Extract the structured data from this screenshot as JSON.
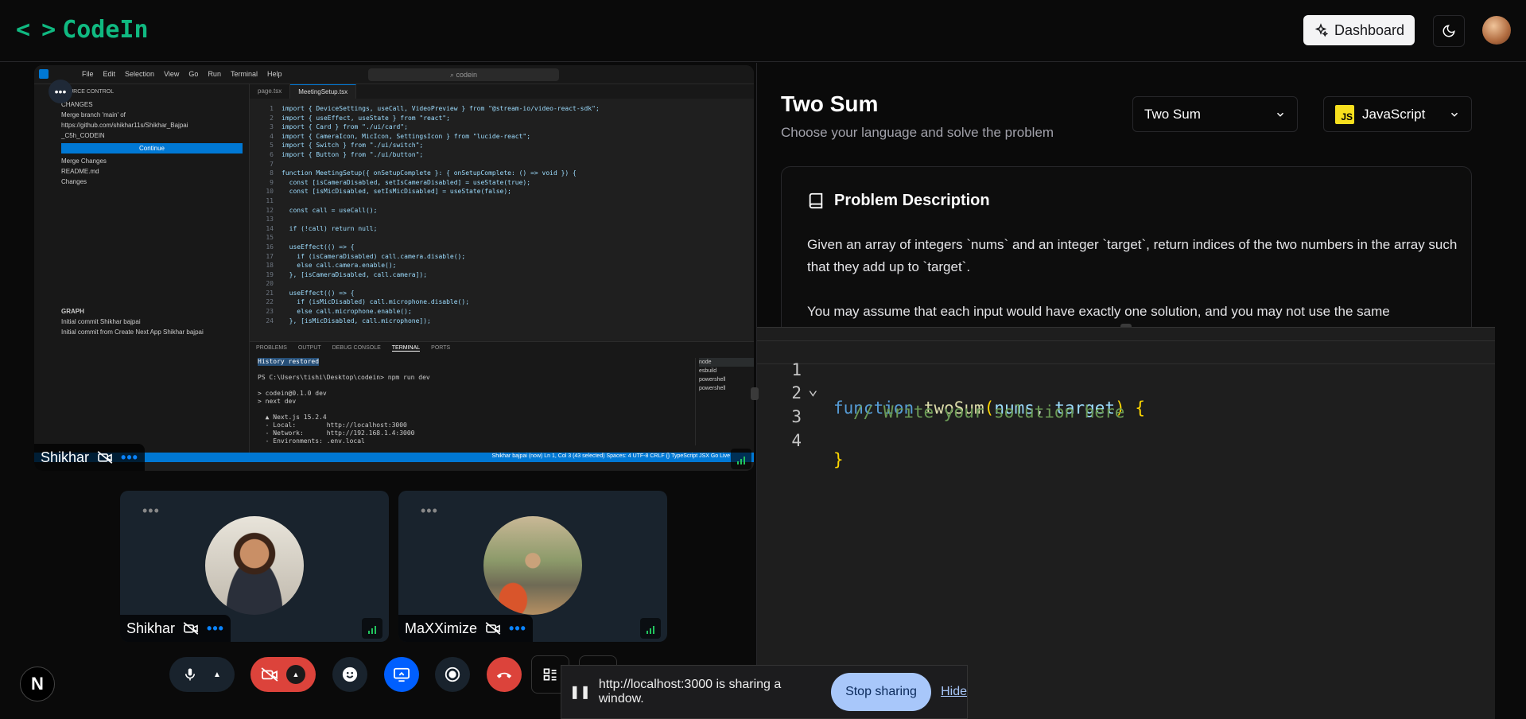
{
  "app": {
    "logo_text": "CodeIn",
    "logo_glyph": "< >"
  },
  "topbar": {
    "dashboard_label": "Dashboard"
  },
  "screenshare": {
    "presenter_name": "Shikhar",
    "vscode": {
      "menu": [
        "File",
        "Edit",
        "Selection",
        "View",
        "Go",
        "Run",
        "Terminal",
        "Help"
      ],
      "search": "codein",
      "tabs": [
        "page.tsx",
        "MeetingSetup.tsx"
      ],
      "side_title": "SOURCE CONTROL",
      "side_lines": [
        "CHANGES",
        "Merge branch 'main' of",
        "https://github.com/shikhar11s/Shikhar_Bajpai",
        "_C5h_CODEIN",
        "Continue",
        "Merge Changes",
        "README.md",
        "Changes",
        "GRAPH",
        "Initial commit  Shikhar bajpai",
        "Initial commit from Create Next App  Shikhar bajpai"
      ],
      "code": [
        "import { DeviceSettings, useCall, VideoPreview } from \"@stream-io/video-react-sdk\";",
        "import { useEffect, useState } from \"react\";",
        "import { Card } from \"./ui/card\";",
        "import { CameraIcon, MicIcon, SettingsIcon } from \"lucide-react\";",
        "import { Switch } from \"./ui/switch\";",
        "import { Button } from \"./ui/button\";",
        "",
        "function MeetingSetup({ onSetupComplete }: { onSetupComplete: () => void }) {",
        "  const [isCameraDisabled, setIsCameraDisabled] = useState(true);",
        "  const [isMicDisabled, setIsMicDisabled] = useState(false);",
        "",
        "  const call = useCall();",
        "",
        "  if (!call) return null;",
        "",
        "  useEffect(() => {",
        "    if (isCameraDisabled) call.camera.disable();",
        "    else call.camera.enable();",
        "  }, [isCameraDisabled, call.camera]);",
        "",
        "  useEffect(() => {",
        "    if (isMicDisabled) call.microphone.disable();",
        "    else call.microphone.enable();",
        "  }, [isMicDisabled, call.microphone]);"
      ],
      "terminal_tabs": [
        "PROBLEMS",
        "OUTPUT",
        "DEBUG CONSOLE",
        "TERMINAL",
        "PORTS"
      ],
      "terminal_lines": [
        "History restored",
        "",
        "PS C:\\Users\\tishi\\Desktop\\codein> npm run dev",
        "",
        "> codein@0.1.0 dev",
        "> next dev",
        "",
        "  ▲ Next.js 15.2.4",
        "  - Local:        http://localhost:3000",
        "  - Network:      http://192.168.1.4:3000",
        "  - Environments: .env.local"
      ],
      "terminal_list": [
        "node",
        "esbuild",
        "powershell",
        "powershell"
      ],
      "status": "Shikhar bajpai (now)   Ln 1, Col 3 (43 selected)   Spaces: 4   UTF-8   CRLF   {} TypeScript JSX   Go Live"
    }
  },
  "participants": [
    {
      "name": "Shikhar"
    },
    {
      "name": "MaXXimize"
    }
  ],
  "share_bar": {
    "message": "http://localhost:3000 is sharing a window.",
    "stop_label": "Stop sharing",
    "hide_label": "Hide"
  },
  "next_badge": "N",
  "problem": {
    "title": "Two Sum",
    "subtitle": "Choose your language and solve the problem",
    "selected_problem": "Two Sum",
    "selected_language": "JavaScript",
    "js_badge": "JS",
    "description_heading": "Problem Description",
    "description_p1": "Given an array of integers `nums` and an integer `target`, return indices of the two numbers in the array such that they add up to `target`.",
    "description_p2": "You may assume that each input would have exactly one solution, and you may not use the same"
  },
  "editor": {
    "line_numbers": [
      "1",
      "2",
      "3",
      "4"
    ],
    "kw_function": "function",
    "fn_name": "twoSum",
    "open_paren": "(",
    "param1": "nums",
    "comma": ", ",
    "param2": "target",
    "close_paren": ")",
    "open_brace": "{",
    "comment": "// Write your solution here",
    "close_brace": "}"
  },
  "colors": {
    "accent": "#10b981",
    "danger": "#ef4444",
    "primary": "#0a84ff"
  }
}
